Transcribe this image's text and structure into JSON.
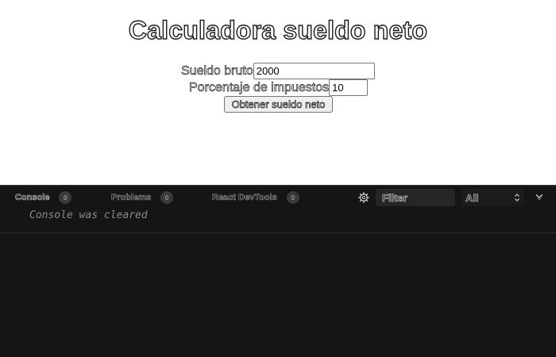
{
  "preview": {
    "title": "Calculadora sueldo neto",
    "gross_label": "Sueldo bruto",
    "gross_value": "2000",
    "tax_label": "Porcentaje de impuestos",
    "tax_value": "10",
    "submit_label": "Obtener sueldo neto"
  },
  "console": {
    "tabs": [
      {
        "label": "Console",
        "count": "0"
      },
      {
        "label": "Problems",
        "count": "0"
      },
      {
        "label": "React DevTools",
        "count": "0"
      }
    ],
    "filter_text": "Filter",
    "level_value": "All",
    "log_message": "Console was cleared"
  },
  "icons": {
    "settings": "gear-icon",
    "level_select": "updown-chevron-icon",
    "collapse": "chevron-down-icon"
  },
  "colors": {
    "console_bg": "#151515",
    "preview_bg": "#ffffff",
    "badge_bg": "#3a3a3a"
  }
}
